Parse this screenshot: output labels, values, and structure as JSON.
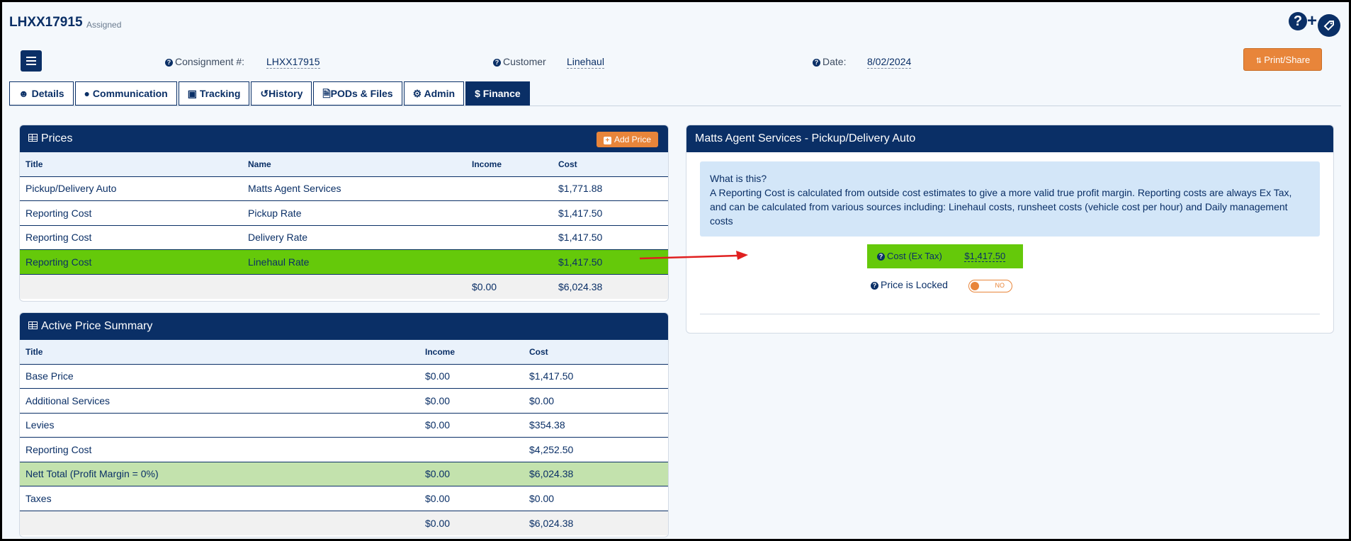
{
  "header": {
    "title": "LHXX17915",
    "status": "Assigned"
  },
  "top_icons": {
    "help": "?",
    "plus": "+",
    "tag": "tag-icon"
  },
  "info_bar": {
    "consignment_label": "Consignment #:",
    "consignment_value": "LHXX17915",
    "customer_label": "Customer",
    "customer_value": "Linehaul",
    "date_label": "Date:",
    "date_value": "8/02/2024",
    "print_label": "Print/Share"
  },
  "tabs": [
    {
      "label": "Details",
      "icon": "user-icon"
    },
    {
      "label": "Communication",
      "icon": "comment-icon"
    },
    {
      "label": "Tracking",
      "icon": "truck-icon"
    },
    {
      "label": "History",
      "icon": "history-icon"
    },
    {
      "label": "PODs & Files",
      "icon": "file-icon"
    },
    {
      "label": "Admin",
      "icon": "gear-icon"
    },
    {
      "label": "Finance",
      "icon": "dollar-icon"
    }
  ],
  "prices": {
    "title": "Prices",
    "add_label": "Add Price",
    "columns": [
      "Title",
      "Name",
      "Income",
      "Cost"
    ],
    "rows": [
      [
        "Pickup/Delivery Auto",
        "Matts Agent Services",
        "",
        "$1,771.88"
      ],
      [
        "Reporting Cost",
        "Pickup Rate",
        "",
        "$1,417.50"
      ],
      [
        "Reporting Cost",
        "Delivery Rate",
        "",
        "$1,417.50"
      ],
      [
        "Reporting Cost",
        "Linehaul Rate",
        "",
        "$1,417.50"
      ]
    ],
    "footer": [
      "",
      "",
      "$0.00",
      "$6,024.38"
    ]
  },
  "summary": {
    "title": "Active Price Summary",
    "columns": [
      "Title",
      "Income",
      "Cost"
    ],
    "rows": [
      [
        "Base Price",
        "$0.00",
        "$1,417.50"
      ],
      [
        "Additional Services",
        "$0.00",
        "$0.00"
      ],
      [
        "Levies",
        "$0.00",
        "$354.38"
      ],
      [
        "Reporting Cost",
        "",
        "$4,252.50"
      ],
      [
        "Nett Total (Profit Margin = 0%)",
        "$0.00",
        "$6,024.38"
      ],
      [
        "Taxes",
        "$0.00",
        "$0.00"
      ]
    ],
    "footer": [
      "",
      "$0.00",
      "$6,024.38"
    ]
  },
  "detail": {
    "title": "Matts Agent Services - Pickup/Delivery Auto",
    "info_heading": "What is this?",
    "info_text": "A Reporting Cost is calculated from outside cost estimates to give a more valid true profit margin. Reporting costs are always Ex Tax, and can be calculated from various sources including: Linehaul costs, runsheet costs (vehicle cost per hour) and Daily management costs",
    "cost_label": "Cost (Ex Tax)",
    "cost_value": "$1,417.50",
    "lock_label": "Price is Locked",
    "lock_toggle": "NO"
  },
  "colors": {
    "navy": "#0a2f66",
    "orange": "#e8853a",
    "green": "#65c90a",
    "arrow": "#e02020"
  }
}
